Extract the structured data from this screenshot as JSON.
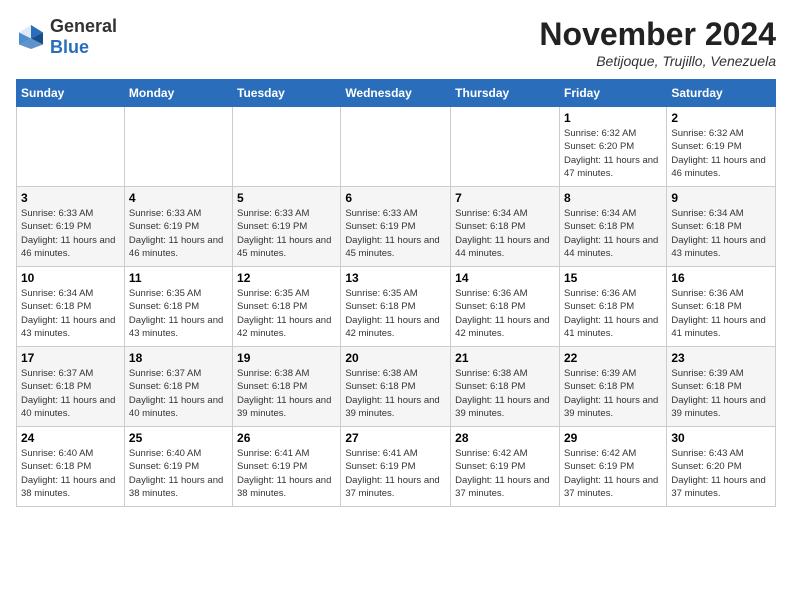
{
  "header": {
    "logo_general": "General",
    "logo_blue": "Blue",
    "month": "November 2024",
    "location": "Betijoque, Trujillo, Venezuela"
  },
  "weekdays": [
    "Sunday",
    "Monday",
    "Tuesday",
    "Wednesday",
    "Thursday",
    "Friday",
    "Saturday"
  ],
  "weeks": [
    [
      {
        "day": "",
        "sunrise": "",
        "sunset": "",
        "daylight": ""
      },
      {
        "day": "",
        "sunrise": "",
        "sunset": "",
        "daylight": ""
      },
      {
        "day": "",
        "sunrise": "",
        "sunset": "",
        "daylight": ""
      },
      {
        "day": "",
        "sunrise": "",
        "sunset": "",
        "daylight": ""
      },
      {
        "day": "",
        "sunrise": "",
        "sunset": "",
        "daylight": ""
      },
      {
        "day": "1",
        "sunrise": "Sunrise: 6:32 AM",
        "sunset": "Sunset: 6:20 PM",
        "daylight": "Daylight: 11 hours and 47 minutes."
      },
      {
        "day": "2",
        "sunrise": "Sunrise: 6:32 AM",
        "sunset": "Sunset: 6:19 PM",
        "daylight": "Daylight: 11 hours and 46 minutes."
      }
    ],
    [
      {
        "day": "3",
        "sunrise": "Sunrise: 6:33 AM",
        "sunset": "Sunset: 6:19 PM",
        "daylight": "Daylight: 11 hours and 46 minutes."
      },
      {
        "day": "4",
        "sunrise": "Sunrise: 6:33 AM",
        "sunset": "Sunset: 6:19 PM",
        "daylight": "Daylight: 11 hours and 46 minutes."
      },
      {
        "day": "5",
        "sunrise": "Sunrise: 6:33 AM",
        "sunset": "Sunset: 6:19 PM",
        "daylight": "Daylight: 11 hours and 45 minutes."
      },
      {
        "day": "6",
        "sunrise": "Sunrise: 6:33 AM",
        "sunset": "Sunset: 6:19 PM",
        "daylight": "Daylight: 11 hours and 45 minutes."
      },
      {
        "day": "7",
        "sunrise": "Sunrise: 6:34 AM",
        "sunset": "Sunset: 6:18 PM",
        "daylight": "Daylight: 11 hours and 44 minutes."
      },
      {
        "day": "8",
        "sunrise": "Sunrise: 6:34 AM",
        "sunset": "Sunset: 6:18 PM",
        "daylight": "Daylight: 11 hours and 44 minutes."
      },
      {
        "day": "9",
        "sunrise": "Sunrise: 6:34 AM",
        "sunset": "Sunset: 6:18 PM",
        "daylight": "Daylight: 11 hours and 43 minutes."
      }
    ],
    [
      {
        "day": "10",
        "sunrise": "Sunrise: 6:34 AM",
        "sunset": "Sunset: 6:18 PM",
        "daylight": "Daylight: 11 hours and 43 minutes."
      },
      {
        "day": "11",
        "sunrise": "Sunrise: 6:35 AM",
        "sunset": "Sunset: 6:18 PM",
        "daylight": "Daylight: 11 hours and 43 minutes."
      },
      {
        "day": "12",
        "sunrise": "Sunrise: 6:35 AM",
        "sunset": "Sunset: 6:18 PM",
        "daylight": "Daylight: 11 hours and 42 minutes."
      },
      {
        "day": "13",
        "sunrise": "Sunrise: 6:35 AM",
        "sunset": "Sunset: 6:18 PM",
        "daylight": "Daylight: 11 hours and 42 minutes."
      },
      {
        "day": "14",
        "sunrise": "Sunrise: 6:36 AM",
        "sunset": "Sunset: 6:18 PM",
        "daylight": "Daylight: 11 hours and 42 minutes."
      },
      {
        "day": "15",
        "sunrise": "Sunrise: 6:36 AM",
        "sunset": "Sunset: 6:18 PM",
        "daylight": "Daylight: 11 hours and 41 minutes."
      },
      {
        "day": "16",
        "sunrise": "Sunrise: 6:36 AM",
        "sunset": "Sunset: 6:18 PM",
        "daylight": "Daylight: 11 hours and 41 minutes."
      }
    ],
    [
      {
        "day": "17",
        "sunrise": "Sunrise: 6:37 AM",
        "sunset": "Sunset: 6:18 PM",
        "daylight": "Daylight: 11 hours and 40 minutes."
      },
      {
        "day": "18",
        "sunrise": "Sunrise: 6:37 AM",
        "sunset": "Sunset: 6:18 PM",
        "daylight": "Daylight: 11 hours and 40 minutes."
      },
      {
        "day": "19",
        "sunrise": "Sunrise: 6:38 AM",
        "sunset": "Sunset: 6:18 PM",
        "daylight": "Daylight: 11 hours and 39 minutes."
      },
      {
        "day": "20",
        "sunrise": "Sunrise: 6:38 AM",
        "sunset": "Sunset: 6:18 PM",
        "daylight": "Daylight: 11 hours and 39 minutes."
      },
      {
        "day": "21",
        "sunrise": "Sunrise: 6:38 AM",
        "sunset": "Sunset: 6:18 PM",
        "daylight": "Daylight: 11 hours and 39 minutes."
      },
      {
        "day": "22",
        "sunrise": "Sunrise: 6:39 AM",
        "sunset": "Sunset: 6:18 PM",
        "daylight": "Daylight: 11 hours and 39 minutes."
      },
      {
        "day": "23",
        "sunrise": "Sunrise: 6:39 AM",
        "sunset": "Sunset: 6:18 PM",
        "daylight": "Daylight: 11 hours and 39 minutes."
      }
    ],
    [
      {
        "day": "24",
        "sunrise": "Sunrise: 6:40 AM",
        "sunset": "Sunset: 6:18 PM",
        "daylight": "Daylight: 11 hours and 38 minutes."
      },
      {
        "day": "25",
        "sunrise": "Sunrise: 6:40 AM",
        "sunset": "Sunset: 6:19 PM",
        "daylight": "Daylight: 11 hours and 38 minutes."
      },
      {
        "day": "26",
        "sunrise": "Sunrise: 6:41 AM",
        "sunset": "Sunset: 6:19 PM",
        "daylight": "Daylight: 11 hours and 38 minutes."
      },
      {
        "day": "27",
        "sunrise": "Sunrise: 6:41 AM",
        "sunset": "Sunset: 6:19 PM",
        "daylight": "Daylight: 11 hours and 37 minutes."
      },
      {
        "day": "28",
        "sunrise": "Sunrise: 6:42 AM",
        "sunset": "Sunset: 6:19 PM",
        "daylight": "Daylight: 11 hours and 37 minutes."
      },
      {
        "day": "29",
        "sunrise": "Sunrise: 6:42 AM",
        "sunset": "Sunset: 6:19 PM",
        "daylight": "Daylight: 11 hours and 37 minutes."
      },
      {
        "day": "30",
        "sunrise": "Sunrise: 6:43 AM",
        "sunset": "Sunset: 6:20 PM",
        "daylight": "Daylight: 11 hours and 37 minutes."
      }
    ]
  ]
}
